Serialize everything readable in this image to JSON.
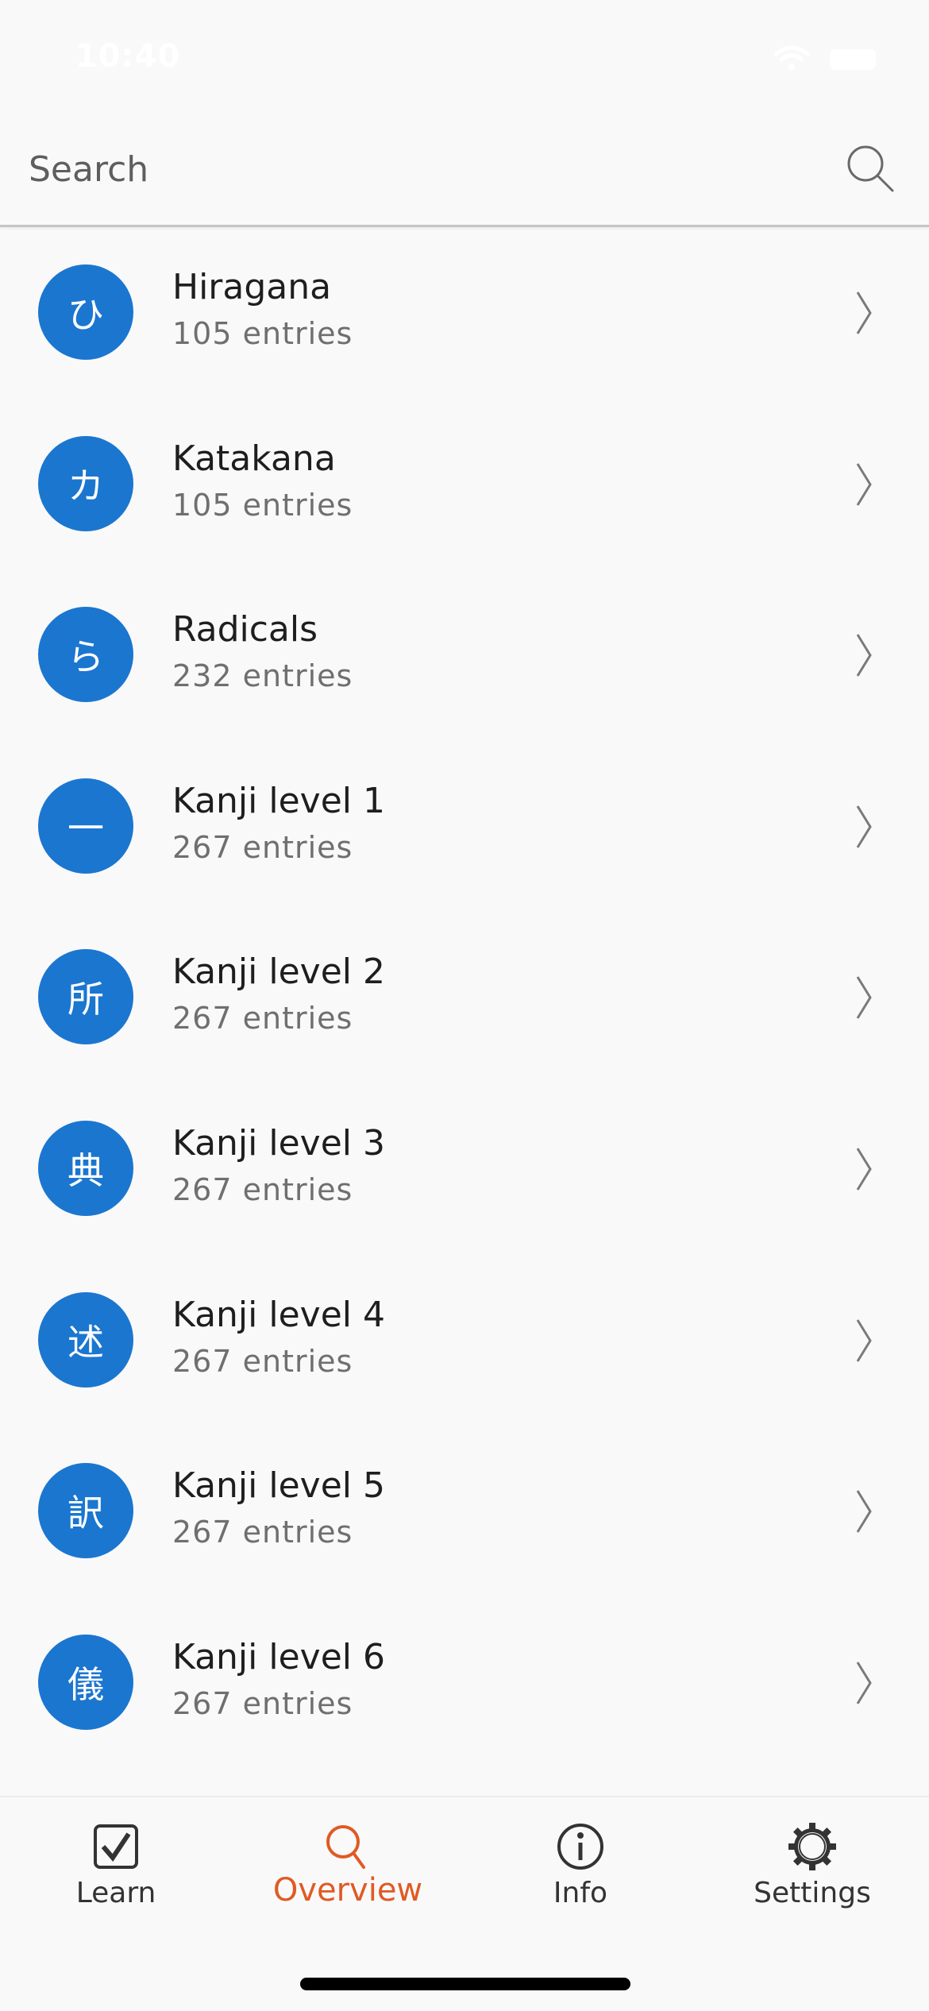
{
  "status_bar": {
    "time": "10:40",
    "wifi_icon": "wifi-icon",
    "battery_icon": "battery-icon"
  },
  "search": {
    "placeholder": "Search",
    "value": "",
    "icon": "search-icon"
  },
  "list": {
    "avatar_color": "#1b76d0",
    "items": [
      {
        "glyph": "ひ",
        "title": "Hiragana",
        "subtitle": "105 entries"
      },
      {
        "glyph": "カ",
        "title": "Katakana",
        "subtitle": "105 entries"
      },
      {
        "glyph": "ら",
        "title": "Radicals",
        "subtitle": "232 entries"
      },
      {
        "glyph": "一",
        "title": "Kanji level 1",
        "subtitle": "267 entries"
      },
      {
        "glyph": "所",
        "title": "Kanji level 2",
        "subtitle": "267 entries"
      },
      {
        "glyph": "典",
        "title": "Kanji level 3",
        "subtitle": "267 entries"
      },
      {
        "glyph": "述",
        "title": "Kanji level 4",
        "subtitle": "267 entries"
      },
      {
        "glyph": "訳",
        "title": "Kanji level 5",
        "subtitle": "267 entries"
      },
      {
        "glyph": "儀",
        "title": "Kanji level 6",
        "subtitle": "267 entries"
      }
    ]
  },
  "tab_bar": {
    "active_color": "#e05a24",
    "tabs": [
      {
        "label": "Learn",
        "icon": "checkbox-checked-icon",
        "active": false
      },
      {
        "label": "Overview",
        "icon": "search-icon",
        "active": true
      },
      {
        "label": "Info",
        "icon": "info-icon",
        "active": false
      },
      {
        "label": "Settings",
        "icon": "gear-icon",
        "active": false
      }
    ]
  }
}
